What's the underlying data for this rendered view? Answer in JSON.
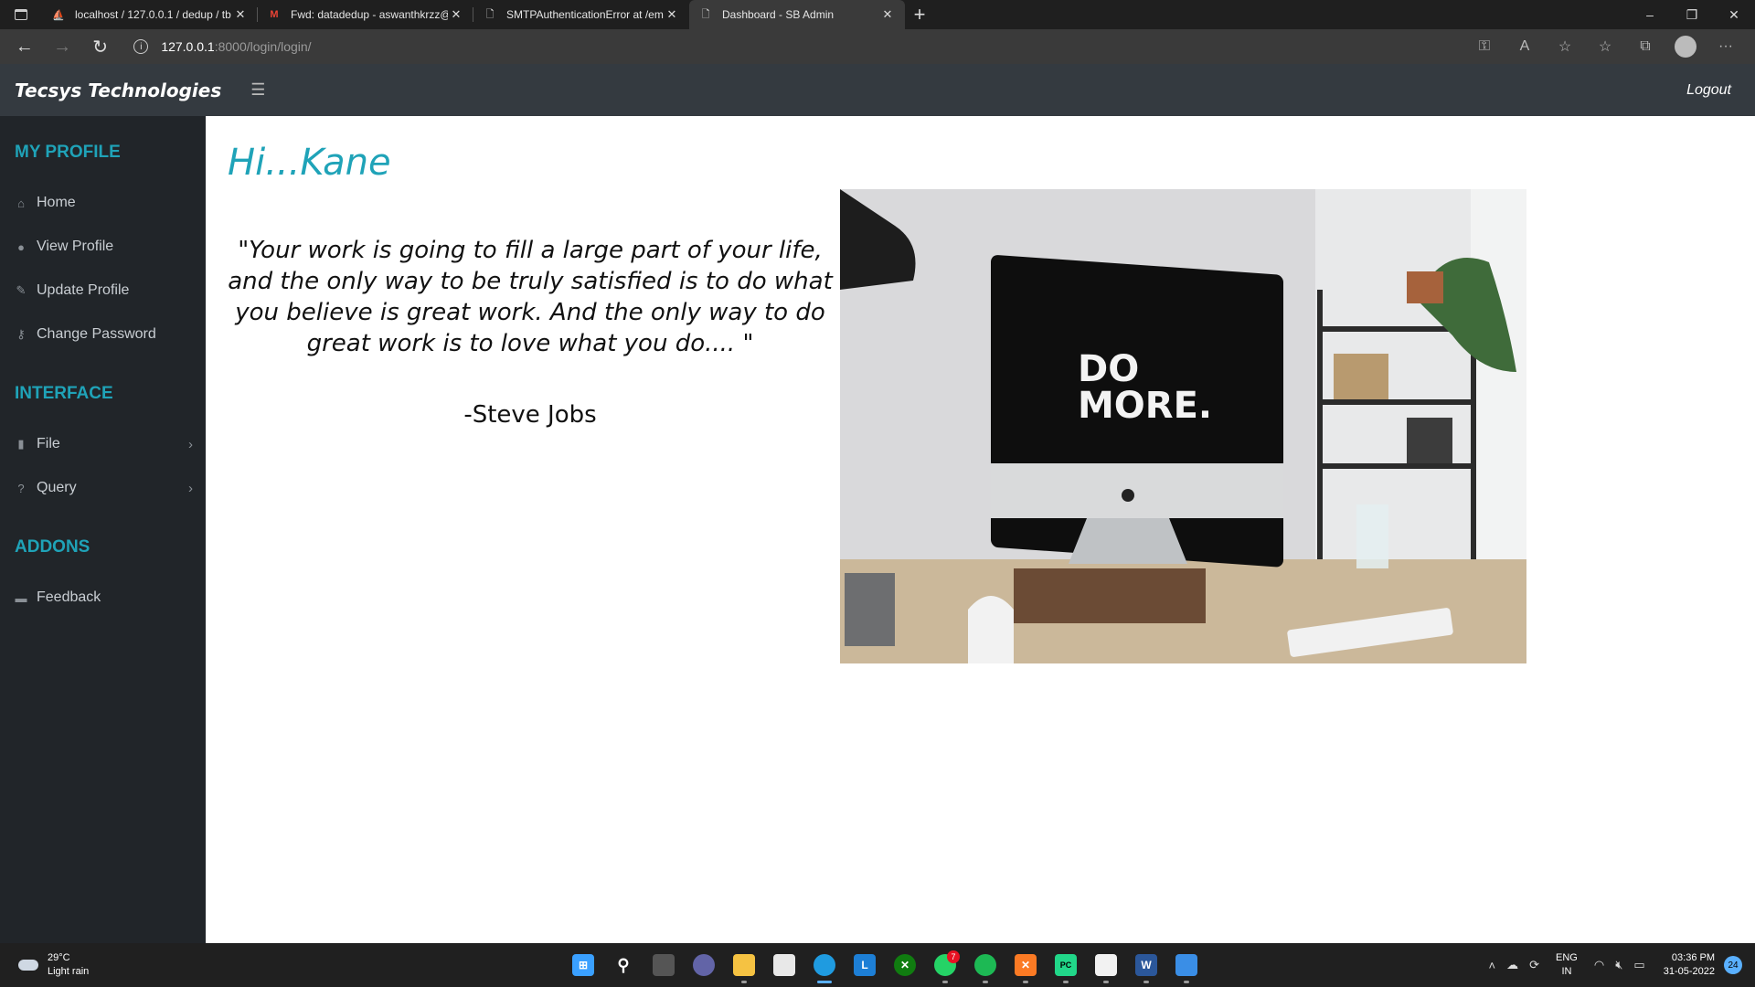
{
  "browser": {
    "tabs": [
      {
        "title": "localhost / 127.0.0.1 / dedup / tb",
        "icon": "phpmyadmin-icon"
      },
      {
        "title": "Fwd: datadedup - aswanthkrzz@",
        "icon": "gmail-icon"
      },
      {
        "title": "SMTPAuthenticationError at /em",
        "icon": "page-icon"
      },
      {
        "title": "Dashboard - SB Admin",
        "icon": "page-icon"
      }
    ],
    "url_host": "127.0.0.1",
    "url_path": ":8000/login/login/"
  },
  "navbar": {
    "brand": "Tecsys Technologies",
    "logout": "Logout"
  },
  "sidebar": {
    "sections": [
      {
        "heading": "MY PROFILE"
      },
      {
        "heading": "INTERFACE"
      },
      {
        "heading": "ADDONS"
      }
    ],
    "items": [
      {
        "label": "Home",
        "icon": "home-icon"
      },
      {
        "label": "View Profile",
        "icon": "user-icon"
      },
      {
        "label": "Update Profile",
        "icon": "user-edit-icon"
      },
      {
        "label": "Change Password",
        "icon": "key-icon"
      },
      {
        "label": "File",
        "icon": "file-icon"
      },
      {
        "label": "Query",
        "icon": "question-circle-icon"
      },
      {
        "label": "Feedback",
        "icon": "comment-icon"
      }
    ]
  },
  "main": {
    "greeting": "Hi...Kane",
    "quote": "\"Your work is going to fill a large part of your life, and the only way to be truly satisfied is to do what you believe is great work. And the only way to do great work is to love what you do.... \"",
    "author": "-Steve Jobs",
    "photo_text_line1": "DO",
    "photo_text_line2": "MORE."
  },
  "taskbar": {
    "temperature": "29°C",
    "weather": "Light rain",
    "whatsapp_badge": "7",
    "lang_line1": "ENG",
    "lang_line2": "IN",
    "time": "03:36 PM",
    "date": "31-05-2022",
    "notifications": "24"
  },
  "colors": {
    "accent": "#1fa3b8",
    "navbar_bg": "#343a40",
    "sidebar_bg": "#212529"
  }
}
